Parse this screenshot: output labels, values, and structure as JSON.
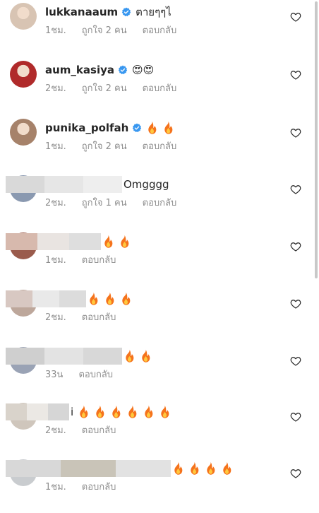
{
  "comments": [
    {
      "username": "lukkanaaum",
      "verified": true,
      "text": "ตายๆๆไ",
      "fire": 0,
      "age": "1ชม.",
      "likes": "ถูกใจ 2 คน",
      "reply": "ตอบกลับ",
      "avatar_color": "#d8c4b3"
    },
    {
      "username": "aum_kasiya",
      "verified": true,
      "text": "😍😍",
      "fire": 0,
      "age": "2ชม.",
      "likes": "ถูกใจ 2 คน",
      "reply": "ตอบกลับ",
      "avatar_color": "#b02a2a"
    },
    {
      "username": "punika_polfah",
      "verified": true,
      "text": "",
      "fire": 2,
      "age": "1ชม.",
      "likes": "ถูกใจ 2 คน",
      "reply": "ตอบกลับ",
      "avatar_color": "#a6826a"
    },
    {
      "username": "",
      "verified": false,
      "text": "Omgggg",
      "fire": 0,
      "age": "2ชม.",
      "likes": "ถูกใจ 1 คน",
      "reply": "ตอบกลับ",
      "avatar_color": "#8a99b0"
    },
    {
      "username": "",
      "verified": false,
      "text": "",
      "fire": 2,
      "age": "1ชม.",
      "likes": "",
      "reply": "ตอบกลับ",
      "avatar_color": "#9a5b4c"
    },
    {
      "username": "",
      "verified": false,
      "text": "",
      "fire": 3,
      "age": "2ชม.",
      "likes": "",
      "reply": "ตอบกลับ",
      "avatar_color": "#bda79b"
    },
    {
      "username": "",
      "verified": false,
      "text": "",
      "fire": 2,
      "age": "33น",
      "likes": "",
      "reply": "ตอบกลับ",
      "avatar_color": "#9aa3b5"
    },
    {
      "username": "",
      "verified": false,
      "text": "i",
      "fire": 6,
      "age": "2ชม.",
      "likes": "",
      "reply": "ตอบกลับ",
      "avatar_color": "#cfc6bc"
    },
    {
      "username": "",
      "verified": false,
      "text": "",
      "fire": 4,
      "age": "1ชม.",
      "likes": "",
      "reply": "ตอบกลับ",
      "avatar_color": "#c9cccf"
    }
  ],
  "icons": {
    "like": "heart-outline-icon",
    "verified": "verified-badge-icon",
    "fire": "fire-emoji-icon"
  },
  "colors": {
    "verified": "#3897f0",
    "fire": "#f5731c",
    "meta": "#8e8e8e"
  }
}
